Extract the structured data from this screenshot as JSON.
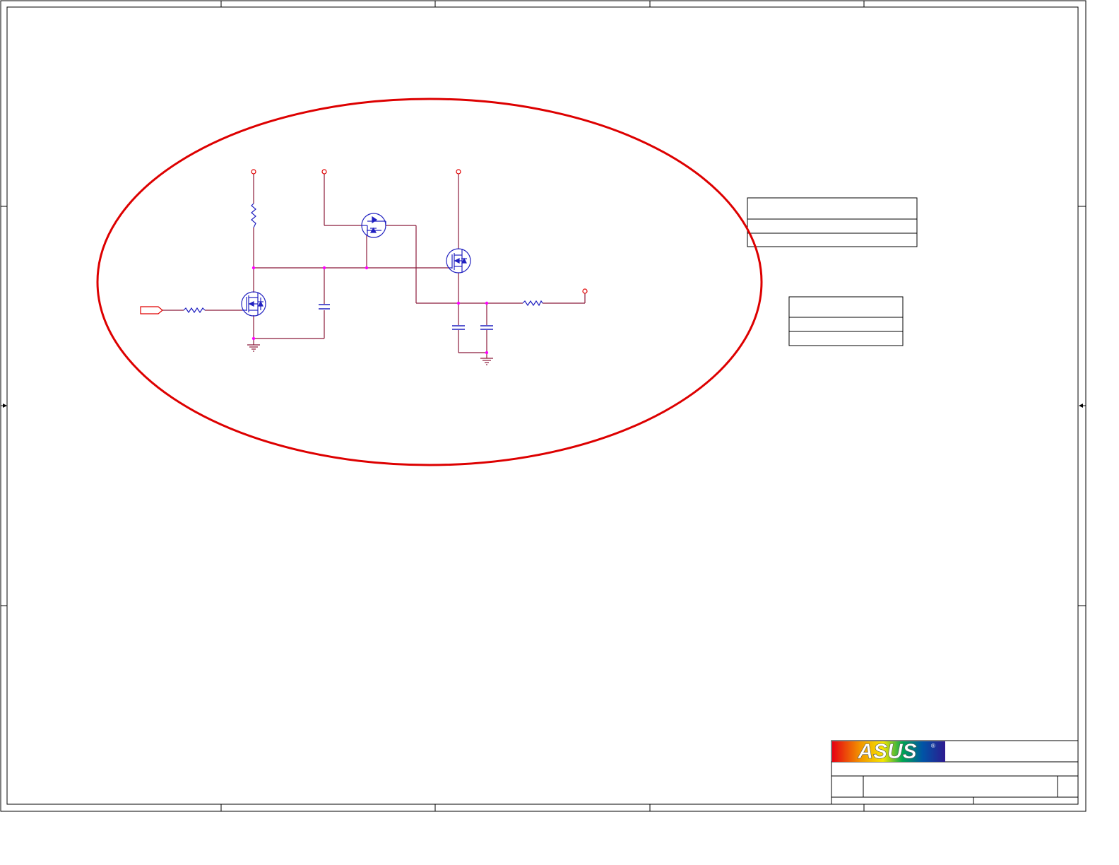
{
  "sheet": {
    "title_block": {
      "logo_text": "ASUS",
      "logo_mark": "®",
      "logo_colors": [
        "#e60012",
        "#f29600",
        "#f5e600",
        "#00a651",
        "#0054a6",
        "#2e1a8f"
      ]
    },
    "colors": {
      "wire": "#8b1a3a",
      "net_port": "#e00000",
      "component": "#2020c0",
      "junction": "#ff00ff",
      "highlight_ellipse": "#dd0000",
      "frame": "#000000"
    },
    "highlight_ellipse": "red-circle-annotation"
  }
}
